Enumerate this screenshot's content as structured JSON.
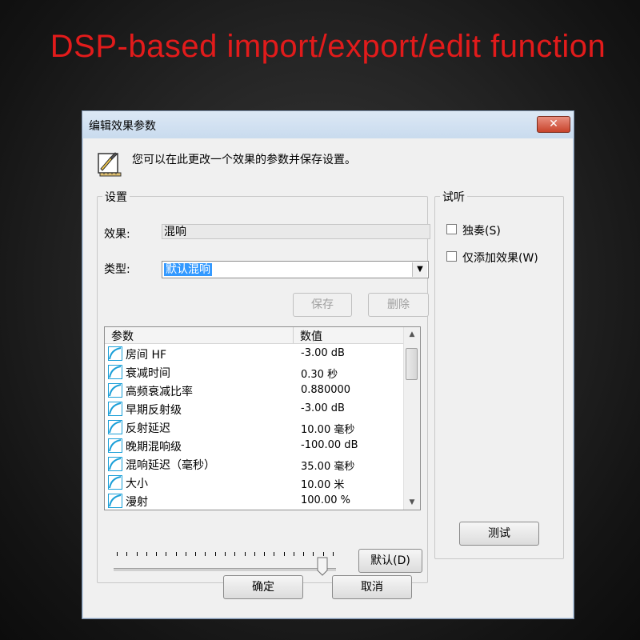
{
  "banner": "DSP-based import/export/edit function",
  "window": {
    "title": "编辑效果参数",
    "close_label": "✕",
    "intro_text": "您可以在此更改一个效果的参数并保存设置。"
  },
  "settings": {
    "group_label": "设置",
    "effect_label": "效果:",
    "effect_value": "混响",
    "type_label": "类型:",
    "type_value": "默认混响",
    "save_label": "保存",
    "delete_label": "删除",
    "columns": [
      "参数",
      "数值"
    ],
    "params": [
      {
        "name": "房间 HF",
        "value": "-3.00 dB"
      },
      {
        "name": "衰减时间",
        "value": "0.30 秒"
      },
      {
        "name": "高频衰减比率",
        "value": "0.880000"
      },
      {
        "name": "早期反射级",
        "value": "-3.00 dB"
      },
      {
        "name": "反射延迟",
        "value": "10.00 毫秒"
      },
      {
        "name": "晚期混响级",
        "value": "-100.00 dB"
      },
      {
        "name": "混响延迟（毫秒）",
        "value": "35.00 毫秒"
      },
      {
        "name": "大小",
        "value": "10.00 米"
      },
      {
        "name": "漫射",
        "value": "100.00 %"
      }
    ],
    "slider_fraction": 0.95,
    "default_label": "默认(D)"
  },
  "listen": {
    "group_label": "试听",
    "solo_label": "独奏(S)",
    "add_only_label": "仅添加效果(W)",
    "test_label": "测试"
  },
  "ok_label": "确定",
  "cancel_label": "取消",
  "colors": {
    "banner": "#e21b1b",
    "selection": "#3399ff",
    "param_icon": "#1a9fd8"
  }
}
